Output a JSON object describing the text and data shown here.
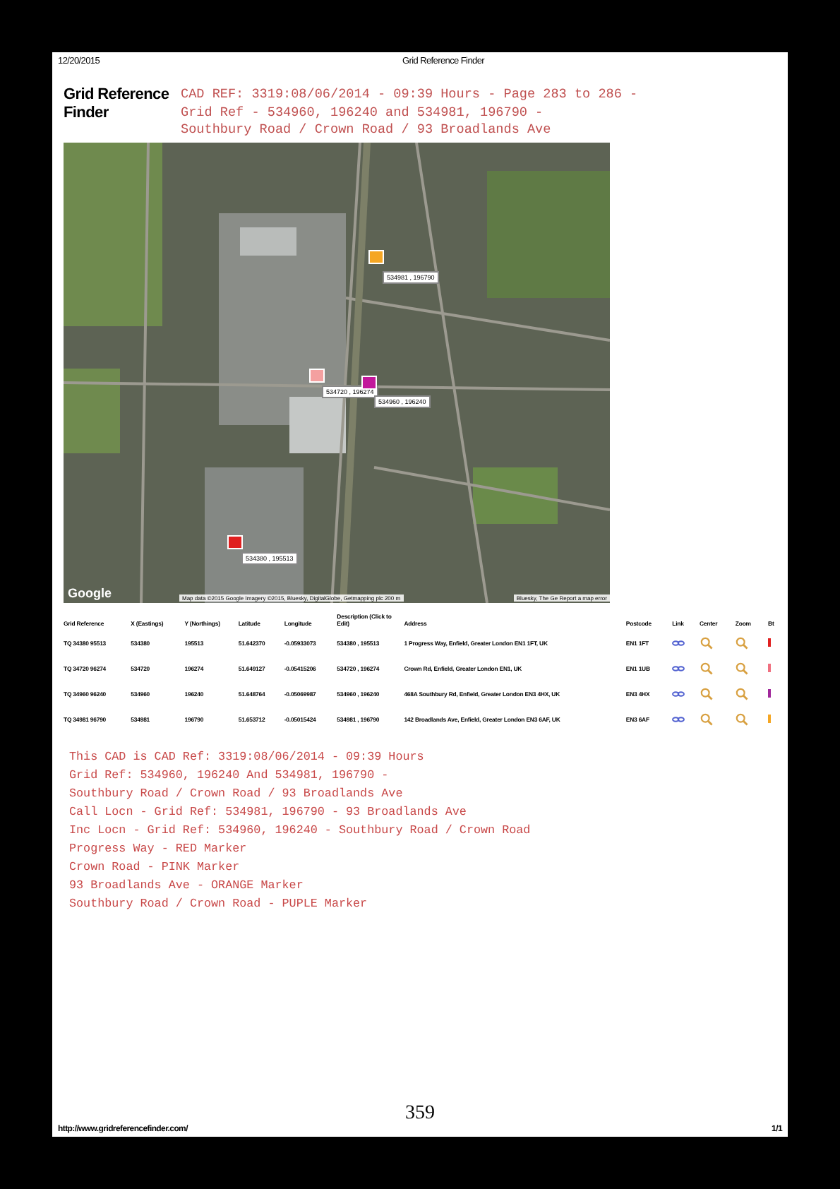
{
  "print_header": {
    "date": "12/20/2015",
    "title": "Grid Reference Finder"
  },
  "site_title": "Grid Reference Finder",
  "heading_lines": [
    "CAD REF: 3319:08/06/2014 - 09:39 Hours - Page 283 to 286 -",
    "Grid Ref - 534960, 196240 and 534981, 196790 -",
    "Southbury Road / Crown Road / 93 Broadlands Ave"
  ],
  "map": {
    "logo": "Google",
    "attribution": "Map data ©2015 Google Imagery ©2015, Bluesky, DigitalGlobe, Getmapping plc 200 m",
    "attribution_right": "Bluesky, The Ge Report a map error",
    "markers": [
      {
        "label": "534981 , 196790",
        "color": "#f5a623"
      },
      {
        "label": "534720 , 196274",
        "color": "#f4a0a0"
      },
      {
        "label": "534960 , 196240",
        "color": "#c2179b"
      },
      {
        "label": "534380 , 195513",
        "color": "#e02020"
      }
    ]
  },
  "table": {
    "columns": [
      "Grid Reference",
      "X (Eastings)",
      "Y (Northings)",
      "Latitude",
      "Longitude",
      "Description (Click to Edit)",
      "Address",
      "Postcode",
      "Link",
      "Center",
      "Zoom",
      "Bt"
    ],
    "rows": [
      {
        "cells": [
          "TQ 34380 95513",
          "534380",
          "195513",
          "51.642370",
          "-0.05933073",
          "534380 , 195513",
          "1 Progress Way, Enfield, Greater London EN1 1FT, UK",
          "EN1 1FT"
        ],
        "color": "#e02020"
      },
      {
        "cells": [
          "TQ 34720 96274",
          "534720",
          "196274",
          "51.649127",
          "-0.05415206",
          "534720 , 196274",
          "Crown Rd, Enfield, Greater London EN1, UK",
          "EN1 1UB"
        ],
        "color": "#f07080"
      },
      {
        "cells": [
          "TQ 34960 96240",
          "534960",
          "196240",
          "51.648764",
          "-0.05069987",
          "534960 , 196240",
          "468A Southbury Rd, Enfield, Greater London EN3 4HX, UK",
          "EN3 4HX"
        ],
        "color": "#a0289b"
      },
      {
        "cells": [
          "TQ 34981 96790",
          "534981",
          "196790",
          "51.653712",
          "-0.05015424",
          "534981 , 196790",
          "142 Broadlands Ave, Enfield, Greater London EN3 6AF, UK",
          "EN3 6AF"
        ],
        "color": "#f5a623"
      }
    ]
  },
  "notes": [
    "This CAD is CAD Ref: 3319:08/06/2014 - 09:39 Hours",
    "Grid Ref: 534960, 196240 And 534981, 196790 -",
    "Southbury Road / Crown Road / 93 Broadlands Ave",
    "Call Locn - Grid Ref: 534981, 196790 - 93 Broadlands Ave",
    "Inc Locn - Grid Ref: 534960, 196240 - Southbury Road / Crown Road",
    "Progress Way - RED Marker",
    "Crown Road - PINK Marker",
    "93 Broadlands Ave  - ORANGE Marker",
    "Southbury Road / Crown Road - PUPLE Marker"
  ],
  "page_number": "359",
  "print_footer": {
    "url": "http://www.gridreferencefinder.com/",
    "page": "1/1"
  }
}
